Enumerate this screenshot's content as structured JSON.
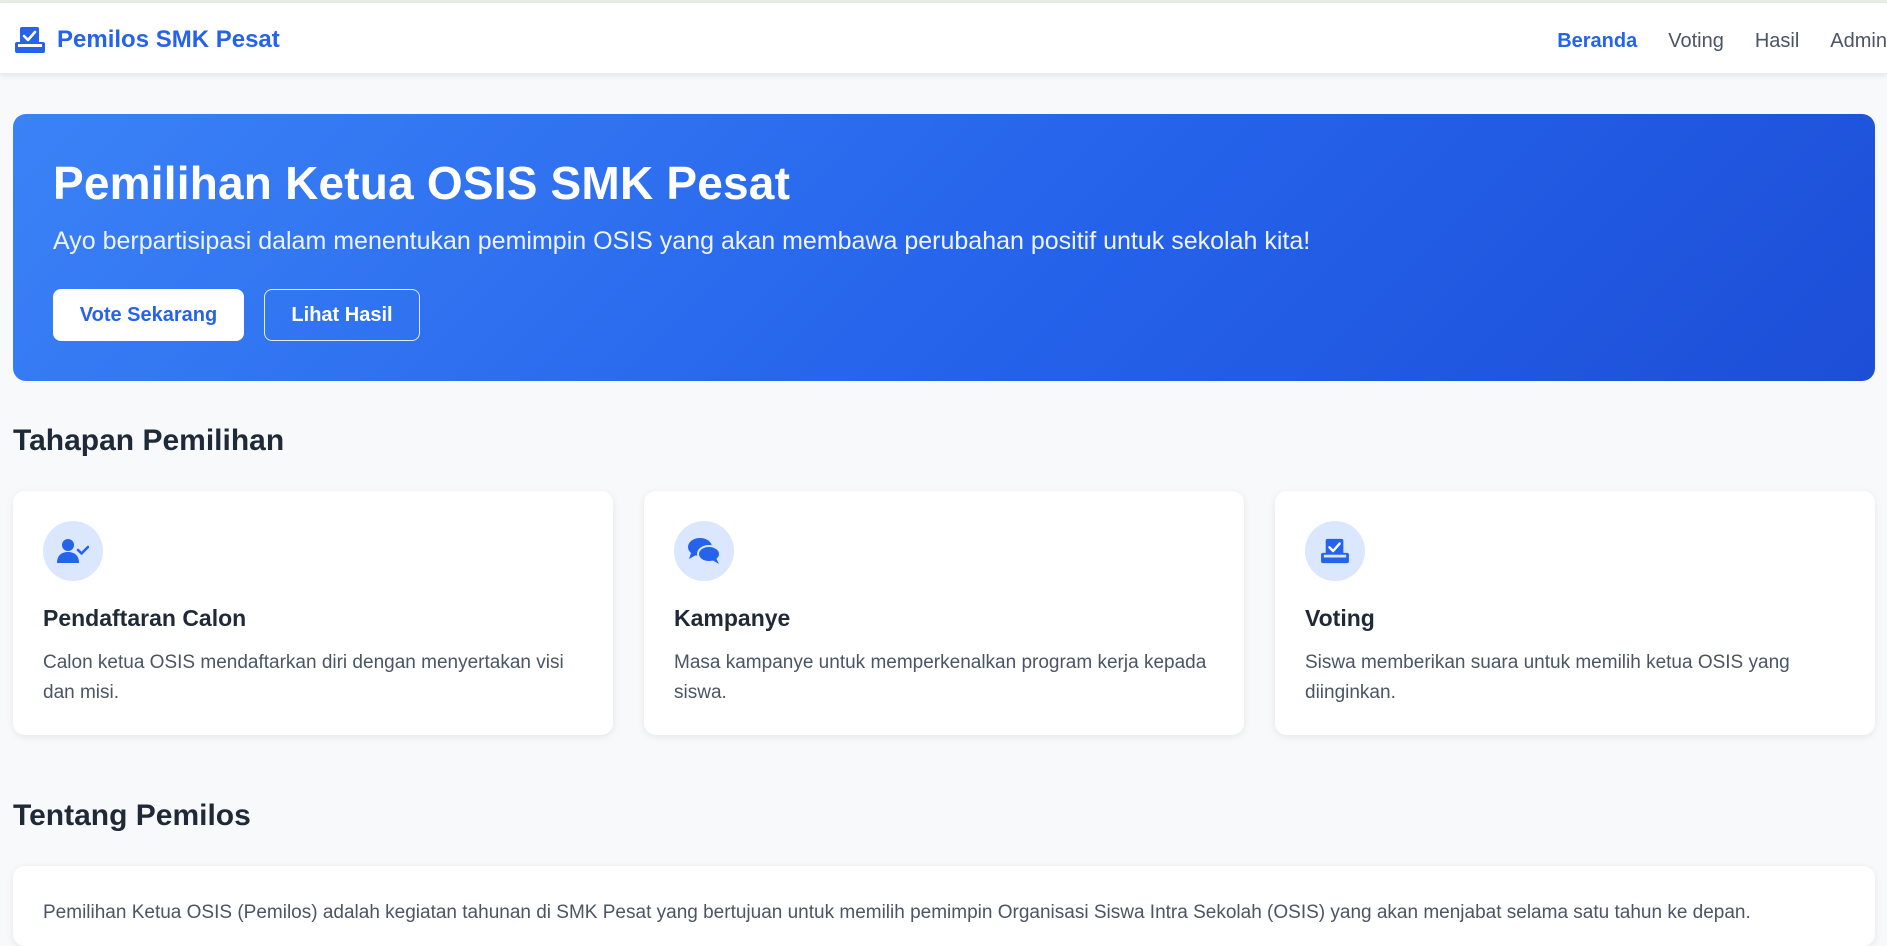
{
  "navbar": {
    "brand": "Pemilos SMK Pesat",
    "brand_icon": "ballot-box-icon",
    "links": [
      "Beranda",
      "Voting",
      "Hasil",
      "Admin"
    ],
    "active_link": "Beranda"
  },
  "hero": {
    "title": "Pemilihan Ketua OSIS SMK Pesat",
    "subtitle": "Ayo berpartisipasi dalam menentukan pemimpin OSIS yang akan membawa perubahan positif untuk sekolah kita!",
    "primary_button": "Vote Sekarang",
    "secondary_button": "Lihat Hasil"
  },
  "stages": {
    "title": "Tahapan Pemilihan",
    "items": [
      {
        "icon": "user-check-icon",
        "title": "Pendaftaran Calon",
        "description": "Calon ketua OSIS mendaftarkan diri dengan menyertakan visi dan misi."
      },
      {
        "icon": "chat-bubbles-icon",
        "title": "Kampanye",
        "description": "Masa kampanye untuk memperkenalkan program kerja kepada siswa."
      },
      {
        "icon": "ballot-box-icon",
        "title": "Voting",
        "description": "Siswa memberikan suara untuk memilih ketua OSIS yang diinginkan."
      }
    ]
  },
  "about": {
    "title": "Tentang Pemilos",
    "text": "Pemilihan Ketua OSIS (Pemilos) adalah kegiatan tahunan di SMK Pesat yang bertujuan untuk memilih pemimpin Organisasi Siswa Intra Sekolah (OSIS) yang akan menjabat selama satu tahun ke depan."
  },
  "colors": {
    "accent": "#2563eb",
    "hero_gradient_start": "#3b82f6",
    "hero_gradient_end": "#1d4ed8",
    "icon_bg": "#dbe7fe"
  }
}
